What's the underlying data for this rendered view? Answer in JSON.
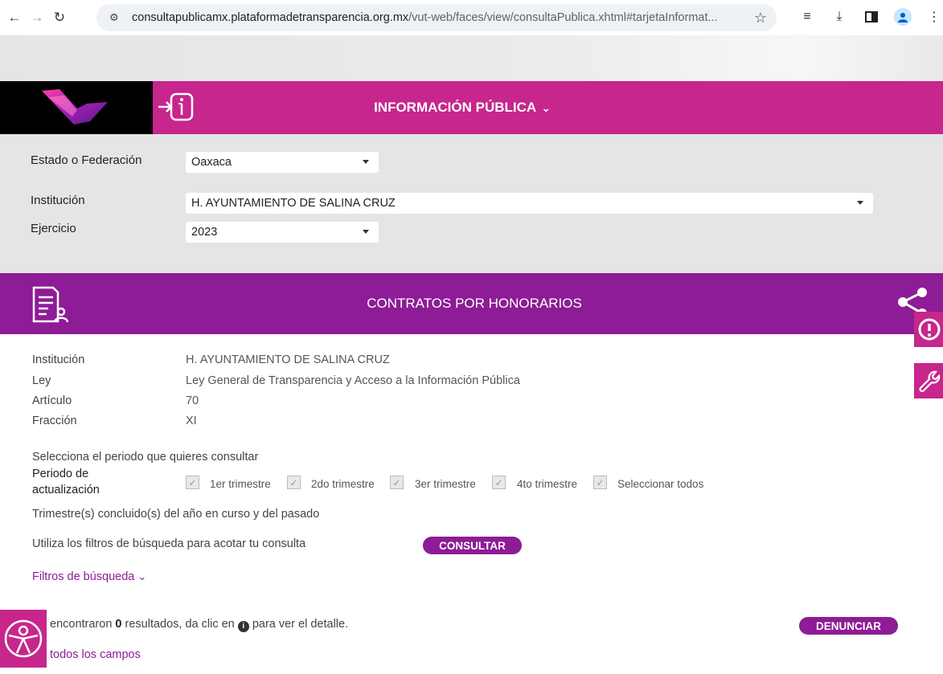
{
  "browser": {
    "url_host": "consultapublicamx.plataformadetransparencia.org.mx",
    "url_rest": "/vut-web/faces/view/consultaPublica.xhtml#tarjetaInformat..."
  },
  "header": {
    "section_title": "INFORMACIÓN PÚBLICA"
  },
  "filters": {
    "estado_label": "Estado o Federación",
    "estado_value": "Oaxaca",
    "institucion_label": "Institución",
    "institucion_value": "H. AYUNTAMIENTO DE SALINA CRUZ",
    "ejercicio_label": "Ejercicio",
    "ejercicio_value": "2023"
  },
  "card": {
    "title": "CONTRATOS POR HONORARIOS"
  },
  "details": {
    "institucion_label": "Institución",
    "institucion_value": "H. AYUNTAMIENTO DE SALINA CRUZ",
    "ley_label": "Ley",
    "ley_value": "Ley General de Transparencia y Acceso a la Información Pública",
    "articulo_label": "Artículo",
    "articulo_value": "70",
    "fraccion_label": "Fracción",
    "fraccion_value": "XI"
  },
  "period": {
    "prompt": "Selecciona el periodo que quieres consultar",
    "label_line1": "Periodo de",
    "label_line2": "actualización",
    "options": [
      "1er trimestre",
      "2do trimestre",
      "3er trimestre",
      "4to trimestre",
      "Seleccionar todos"
    ],
    "note": "Trimestre(s) concluido(s) del año en curso y del pasado"
  },
  "query": {
    "hint": "Utiliza los filtros de búsqueda para acotar tu consulta",
    "consultar_label": "CONSULTAR",
    "filtros_label": "Filtros de búsqueda"
  },
  "results": {
    "text_prefix": "encontraron",
    "count": "0",
    "text_suffix": "resultados, da clic en",
    "text_end": "para ver el detalle.",
    "denunciar_label": "DENUNCIAR",
    "all_fields_label": "todos los campos"
  },
  "colors": {
    "pink": "#c7268c",
    "purple": "#8d1c96",
    "panel_gray": "#e5e5e5"
  }
}
